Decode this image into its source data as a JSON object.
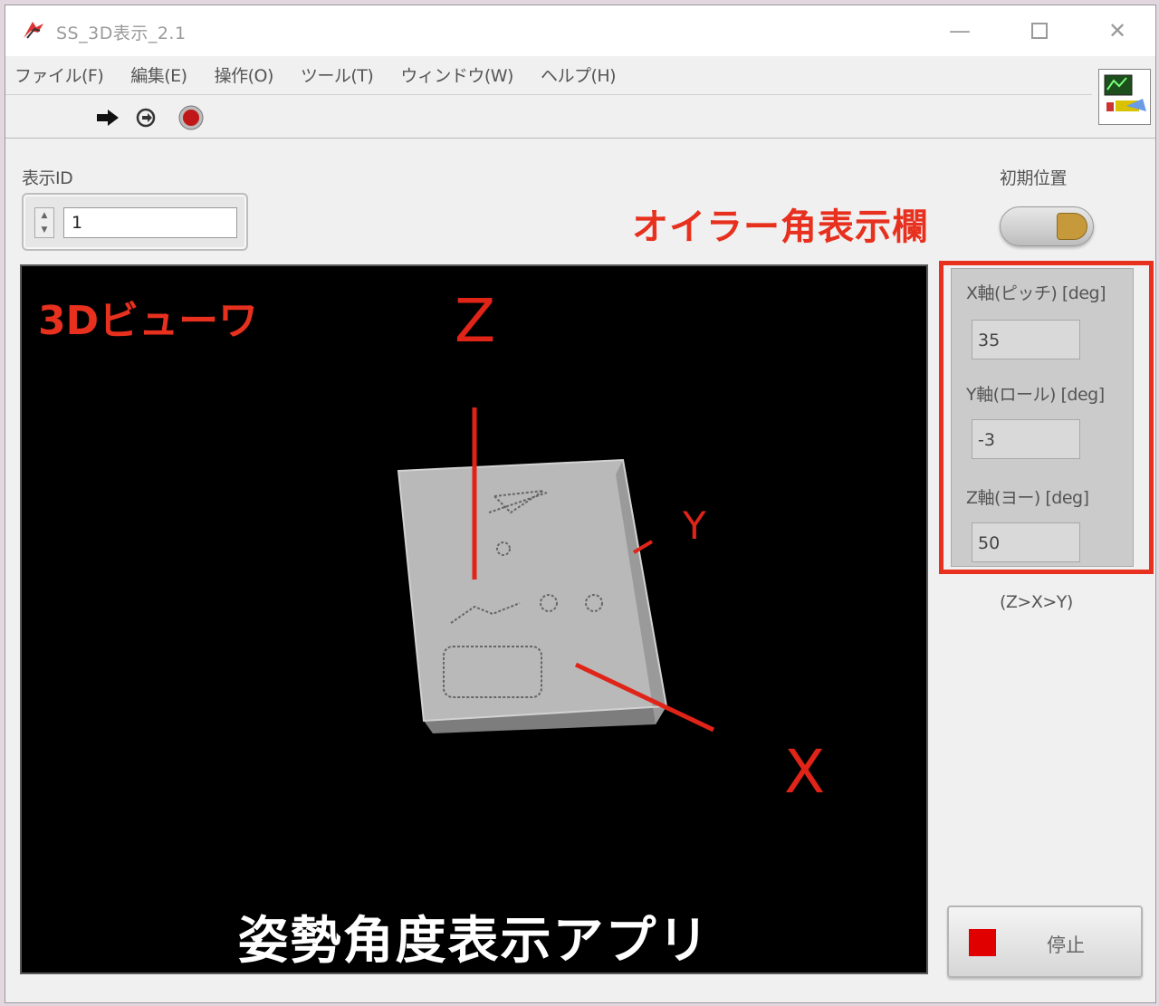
{
  "window": {
    "title": "SS_3D表示_2.1",
    "controls": {
      "minimize": "—",
      "close": "✕"
    }
  },
  "menu": [
    "ファイル(F)",
    "編集(E)",
    "操作(O)",
    "ツール(T)",
    "ウィンドウ(W)",
    "ヘルプ(H)"
  ],
  "display_id": {
    "label": "表示ID",
    "value": "1"
  },
  "initial_position": {
    "label": "初期位置"
  },
  "annotations": {
    "euler": "オイラー角表示欄",
    "viewer": "3Dビューワ"
  },
  "viewer": {
    "app_title": "姿勢角度表示アプリ",
    "axes": {
      "z": "Z",
      "y": "Y",
      "x": "X"
    }
  },
  "euler": {
    "x": {
      "label": "X軸(ピッチ) [deg]",
      "value": "35"
    },
    "y": {
      "label": "Y軸(ロール) [deg]",
      "value": "-3"
    },
    "z": {
      "label": "Z軸(ヨー) [deg]",
      "value": "50"
    },
    "order": "(Z>X>Y)"
  },
  "stop_button": {
    "label": "停止"
  },
  "colors": {
    "annotation": "#e7301e",
    "axis": "#e12418",
    "viewer_bg": "#000000"
  }
}
